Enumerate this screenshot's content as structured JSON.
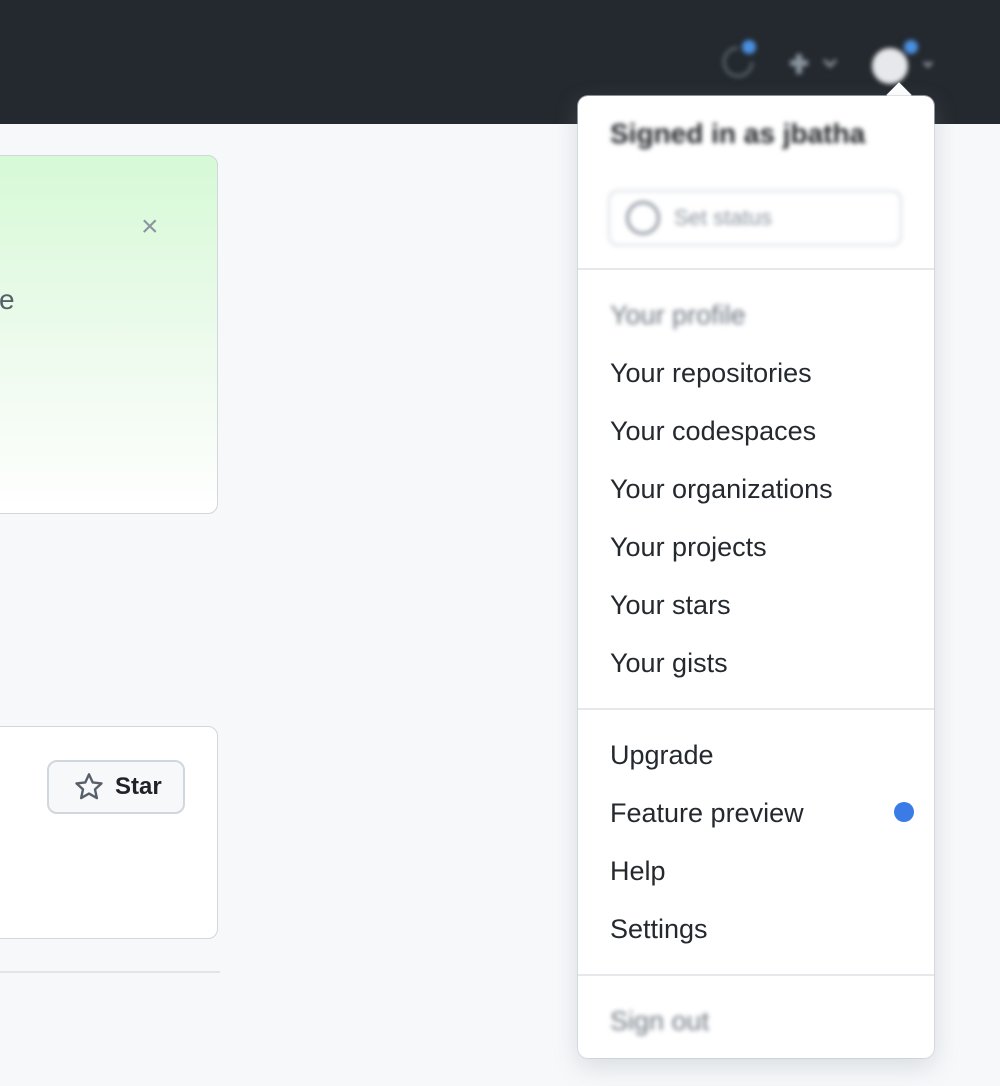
{
  "header": {
    "icons": [
      "inbox-icon",
      "plus-icon",
      "avatar"
    ],
    "accent": "#4a90e2",
    "bar_color": "#24292f"
  },
  "banner": {
    "close_glyph": "×",
    "text_fragment": "e"
  },
  "repo_card": {
    "star_label": "Star"
  },
  "user_menu": {
    "signed_in_text": "Signed in as jbatha",
    "status_placeholder": "Set status",
    "profile_items": [
      "Your profile",
      "Your repositories",
      "Your codespaces",
      "Your organizations",
      "Your projects",
      "Your stars",
      "Your gists"
    ],
    "account_items": [
      "Upgrade",
      "Feature preview",
      "Help",
      "Settings"
    ],
    "sign_out": "Sign out",
    "feature_dot_color": "#3b7be6"
  }
}
